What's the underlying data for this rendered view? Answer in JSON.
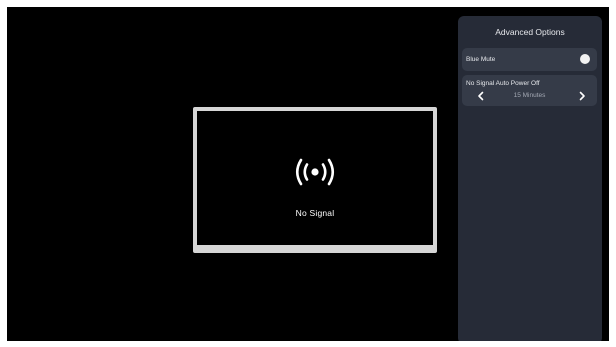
{
  "preview": {
    "status_text": "No Signal",
    "icon": "broadcast-signal-icon"
  },
  "panel": {
    "title": "Advanced Options",
    "options": [
      {
        "label": "Blue Mute",
        "toggle": "off"
      },
      {
        "label": "No Signal Auto Power Off",
        "value": "15 Minutes",
        "prev_icon": "chevron-left-icon",
        "next_icon": "chevron-right-icon"
      }
    ]
  },
  "colors": {
    "screen_bg": "#000000",
    "panel_bg": "#262b37",
    "card_bg": "#353b48",
    "preview_border": "#d6d6d6"
  }
}
